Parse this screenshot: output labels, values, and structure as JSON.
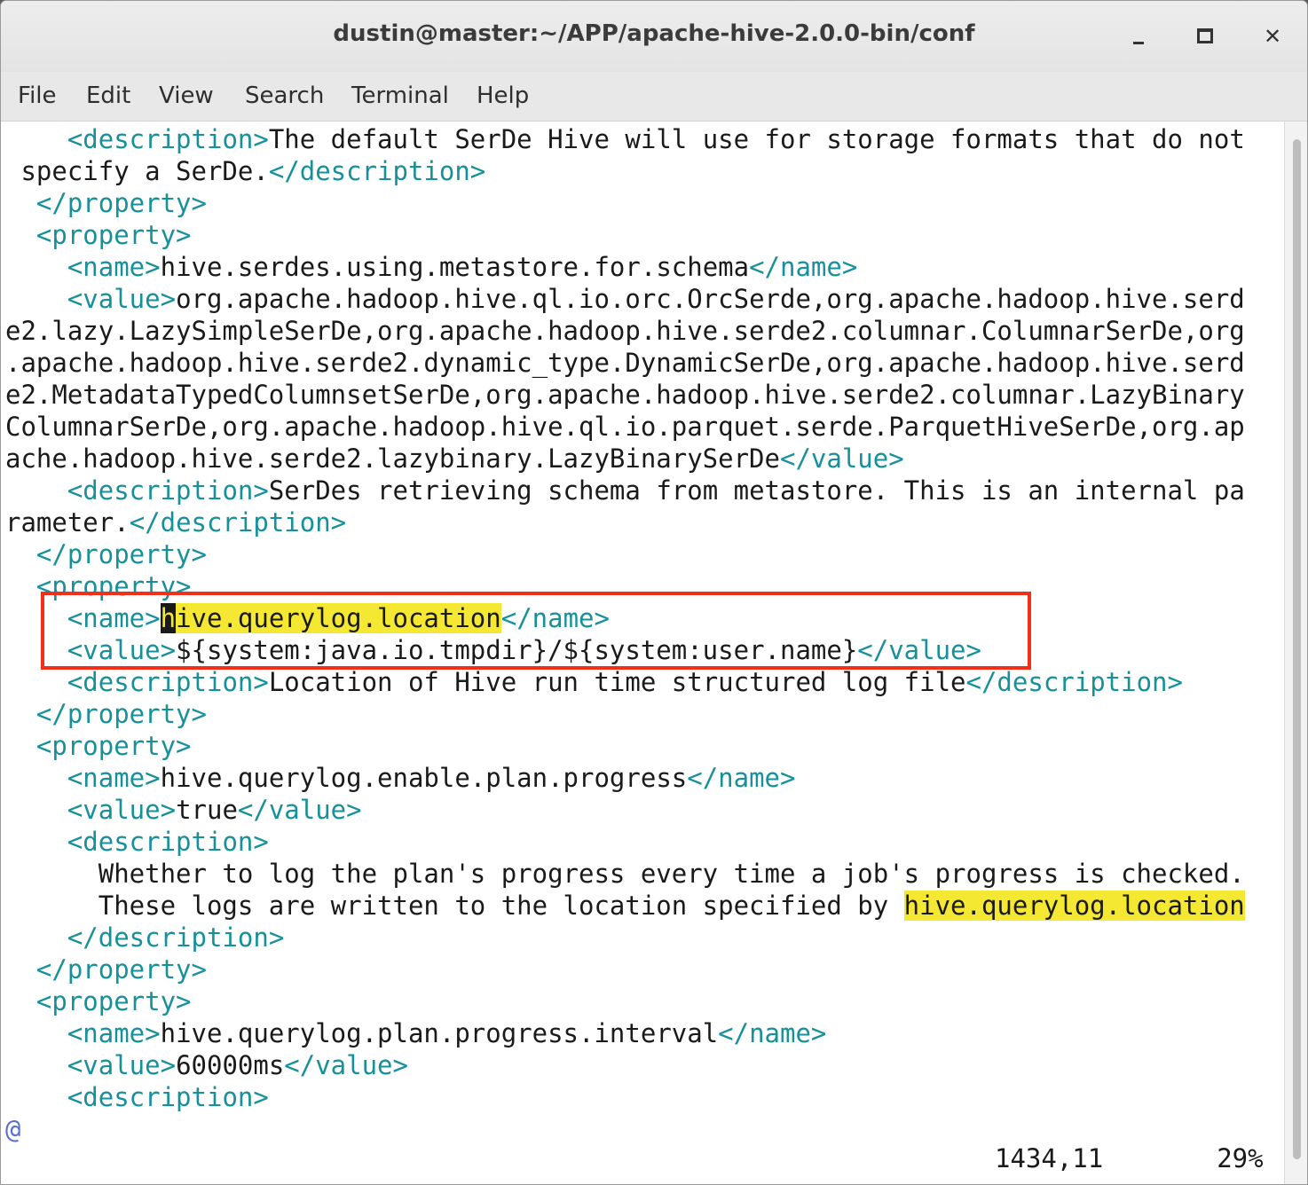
{
  "window": {
    "title": "dustin@master:~/APP/apache-hive-2.0.0-bin/conf",
    "controls": {
      "minimize": "minimize",
      "maximize": "maximize",
      "close": "✕"
    }
  },
  "menu": [
    "File",
    "Edit",
    "View",
    "Search",
    "Terminal",
    "Help"
  ],
  "lines": [
    [
      {
        "t": "    "
      },
      {
        "c": "tag",
        "t": "<description>"
      },
      {
        "t": "The default SerDe Hive will use for storage formats that do not"
      }
    ],
    [
      {
        "t": " specify a SerDe."
      },
      {
        "c": "tag",
        "t": "</description>"
      }
    ],
    [
      {
        "t": "  "
      },
      {
        "c": "tag",
        "t": "</property>"
      }
    ],
    [
      {
        "t": "  "
      },
      {
        "c": "tag",
        "t": "<property>"
      }
    ],
    [
      {
        "t": "    "
      },
      {
        "c": "tag",
        "t": "<name>"
      },
      {
        "t": "hive.serdes.using.metastore.for.schema"
      },
      {
        "c": "tag",
        "t": "</name>"
      }
    ],
    [
      {
        "t": "    "
      },
      {
        "c": "tag",
        "t": "<value>"
      },
      {
        "t": "org.apache.hadoop.hive.ql.io.orc.OrcSerde,org.apache.hadoop.hive.serd"
      }
    ],
    [
      {
        "t": "e2.lazy.LazySimpleSerDe,org.apache.hadoop.hive.serde2.columnar.ColumnarSerDe,org"
      }
    ],
    [
      {
        "t": ".apache.hadoop.hive.serde2.dynamic_type.DynamicSerDe,org.apache.hadoop.hive.serd"
      }
    ],
    [
      {
        "t": "e2.MetadataTypedColumnsetSerDe,org.apache.hadoop.hive.serde2.columnar.LazyBinary"
      }
    ],
    [
      {
        "t": "ColumnarSerDe,org.apache.hadoop.hive.ql.io.parquet.serde.ParquetHiveSerDe,org.ap"
      }
    ],
    [
      {
        "t": "ache.hadoop.hive.serde2.lazybinary.LazyBinarySerDe"
      },
      {
        "c": "tag",
        "t": "</value>"
      }
    ],
    [
      {
        "t": "    "
      },
      {
        "c": "tag",
        "t": "<description>"
      },
      {
        "t": "SerDes retrieving schema from metastore. This is an internal pa"
      }
    ],
    [
      {
        "t": "rameter."
      },
      {
        "c": "tag",
        "t": "</description>"
      }
    ],
    [
      {
        "t": "  "
      },
      {
        "c": "tag",
        "t": "</property>"
      }
    ],
    [
      {
        "t": "  "
      },
      {
        "c": "tag",
        "t": "<property>"
      }
    ],
    [
      {
        "t": "    "
      },
      {
        "c": "tag",
        "t": "<name>"
      },
      {
        "c": "cursor",
        "t": "h"
      },
      {
        "c": "hl",
        "t": "ive.querylog.location"
      },
      {
        "c": "tag",
        "t": "</name>"
      }
    ],
    [
      {
        "t": "    "
      },
      {
        "c": "tag",
        "t": "<value>"
      },
      {
        "t": "${system:java.io.tmpdir}/${system:user.name}"
      },
      {
        "c": "tag",
        "t": "</value>"
      }
    ],
    [
      {
        "t": "    "
      },
      {
        "c": "tag",
        "t": "<description>"
      },
      {
        "t": "Location of Hive run time structured log file"
      },
      {
        "c": "tag",
        "t": "</description>"
      }
    ],
    [
      {
        "t": "  "
      },
      {
        "c": "tag",
        "t": "</property>"
      }
    ],
    [
      {
        "t": "  "
      },
      {
        "c": "tag",
        "t": "<property>"
      }
    ],
    [
      {
        "t": "    "
      },
      {
        "c": "tag",
        "t": "<name>"
      },
      {
        "t": "hive.querylog.enable.plan.progress"
      },
      {
        "c": "tag",
        "t": "</name>"
      }
    ],
    [
      {
        "t": "    "
      },
      {
        "c": "tag",
        "t": "<value>"
      },
      {
        "t": "true"
      },
      {
        "c": "tag",
        "t": "</value>"
      }
    ],
    [
      {
        "t": "    "
      },
      {
        "c": "tag",
        "t": "<description>"
      }
    ],
    [
      {
        "t": "      Whether to log the plan's progress every time a job's progress is checked."
      }
    ],
    [
      {
        "t": "      These logs are written to the location specified by "
      },
      {
        "c": "hl",
        "t": "hive.querylog.location"
      }
    ],
    [
      {
        "t": "    "
      },
      {
        "c": "tag",
        "t": "</description>"
      }
    ],
    [
      {
        "t": "  "
      },
      {
        "c": "tag",
        "t": "</property>"
      }
    ],
    [
      {
        "t": "  "
      },
      {
        "c": "tag",
        "t": "<property>"
      }
    ],
    [
      {
        "t": "    "
      },
      {
        "c": "tag",
        "t": "<name>"
      },
      {
        "t": "hive.querylog.plan.progress.interval"
      },
      {
        "c": "tag",
        "t": "</name>"
      }
    ],
    [
      {
        "t": "    "
      },
      {
        "c": "tag",
        "t": "<value>"
      },
      {
        "t": "60000ms"
      },
      {
        "c": "tag",
        "t": "</value>"
      }
    ],
    [
      {
        "t": "    "
      },
      {
        "c": "tag",
        "t": "<description>"
      }
    ],
    [
      {
        "c": "tilde",
        "t": "@"
      }
    ]
  ],
  "status": {
    "position": "1434,11",
    "percent": "29%"
  },
  "colors": {
    "tag": "#16909a",
    "highlight": "#f5e832",
    "annotation_box": "#f2301a"
  }
}
